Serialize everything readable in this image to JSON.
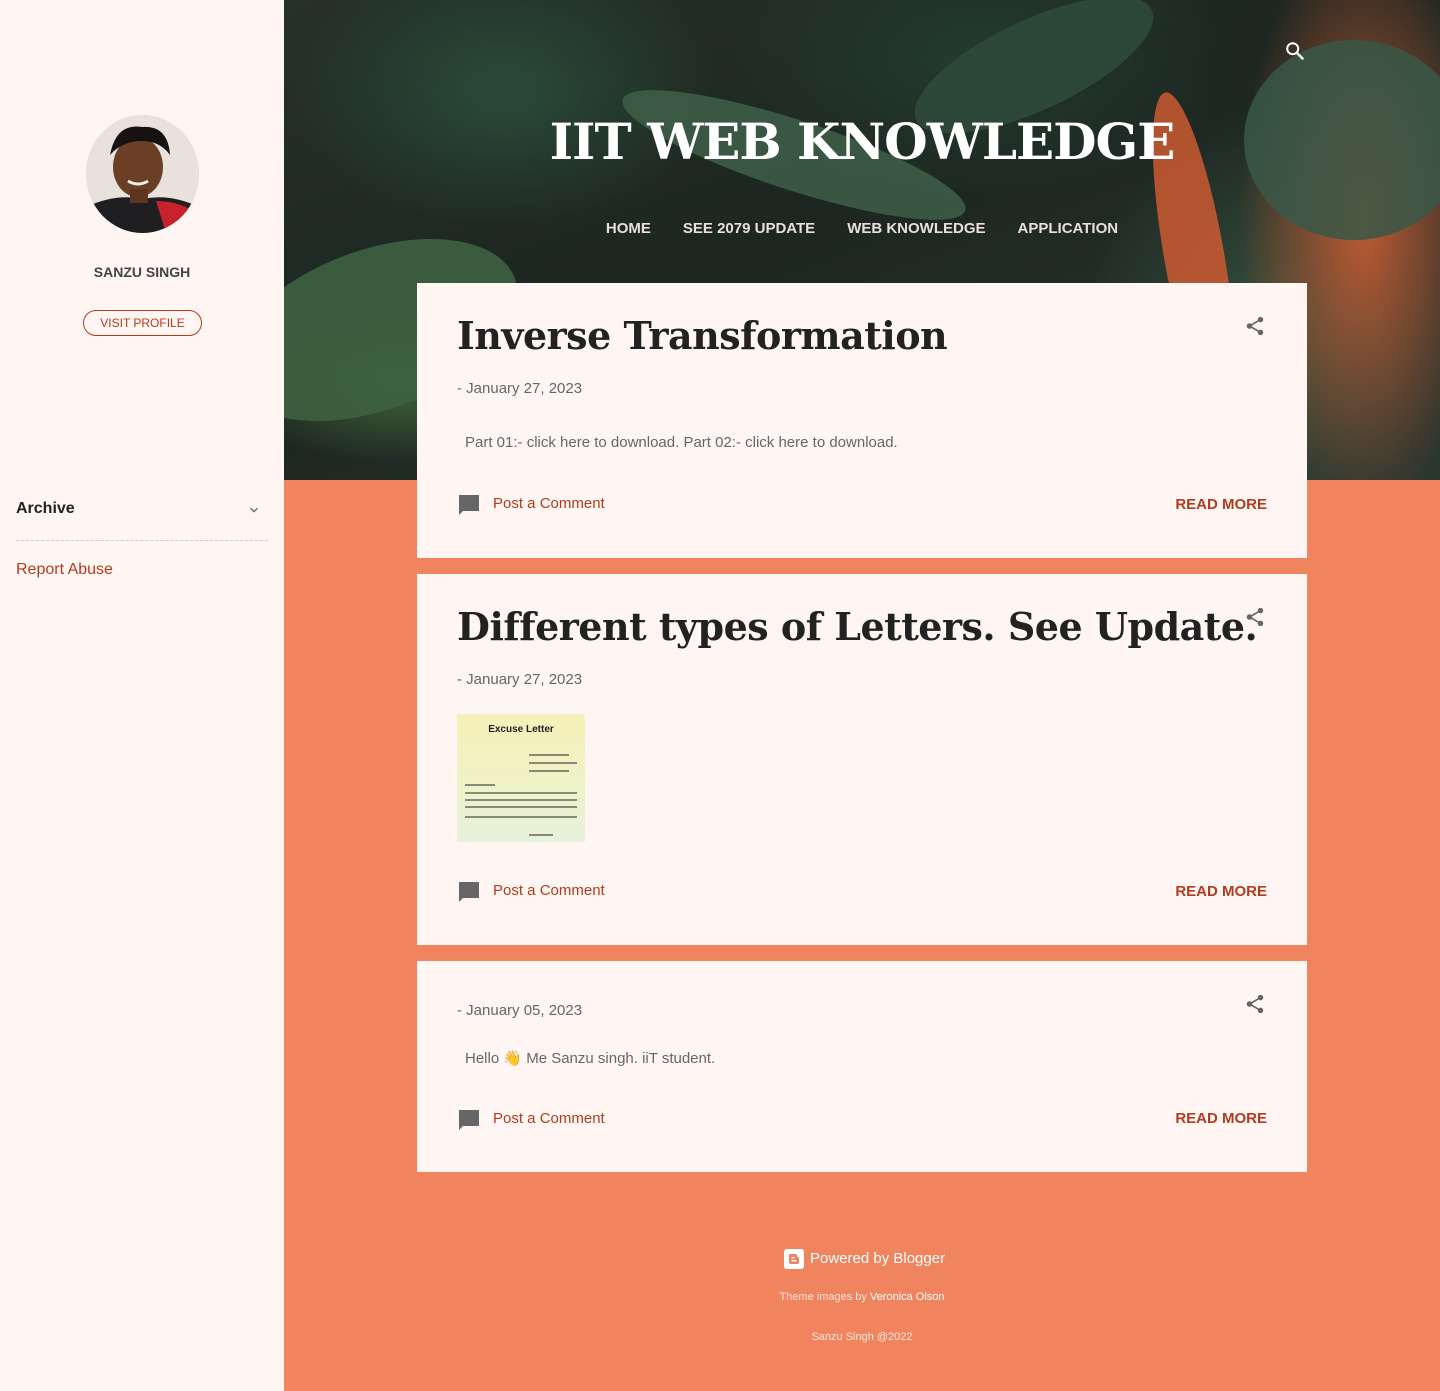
{
  "site": {
    "title": "IIT WEB KNOWLEDGE"
  },
  "nav": [
    "HOME",
    "SEE 2079 UPDATE",
    "WEB KNOWLEDGE",
    "APPLICATION"
  ],
  "sidebar": {
    "profile_name": "SANZU SINGH",
    "visit_profile": "VISIT PROFILE",
    "archive_label": "Archive",
    "report_abuse": "Report Abuse"
  },
  "posts": [
    {
      "title": "Inverse Transformation",
      "date": "- January 27, 2023",
      "snippet": "Part 01:- click here to download.   Part 02:- click here to download.",
      "comment_label": "Post a Comment",
      "read_more": "READ MORE"
    },
    {
      "title": "Different types of Letters. See Update.",
      "date": "- January 27, 2023",
      "thumbnail_title": "Excuse Letter",
      "comment_label": "Post a Comment",
      "read_more": "READ MORE"
    },
    {
      "title": "",
      "date": "- January 05, 2023",
      "snippet": "Hello 👋 Me Sanzu singh. iiT student.",
      "comment_label": "Post a Comment",
      "read_more": "READ MORE"
    }
  ],
  "footer": {
    "powered_by": "Powered by Blogger",
    "theme_prefix": "Theme images by ",
    "theme_author": "Veronica Olson",
    "copyright": "Sanzu Singh @2022"
  },
  "colors": {
    "accent": "#b43c1e",
    "background": "#f0845f",
    "card": "#fff6f4"
  },
  "icons": {
    "search": "search-icon",
    "share": "share-icon",
    "comment": "comment-icon",
    "chevron": "chevron-down-icon",
    "blogger": "blogger-icon"
  }
}
